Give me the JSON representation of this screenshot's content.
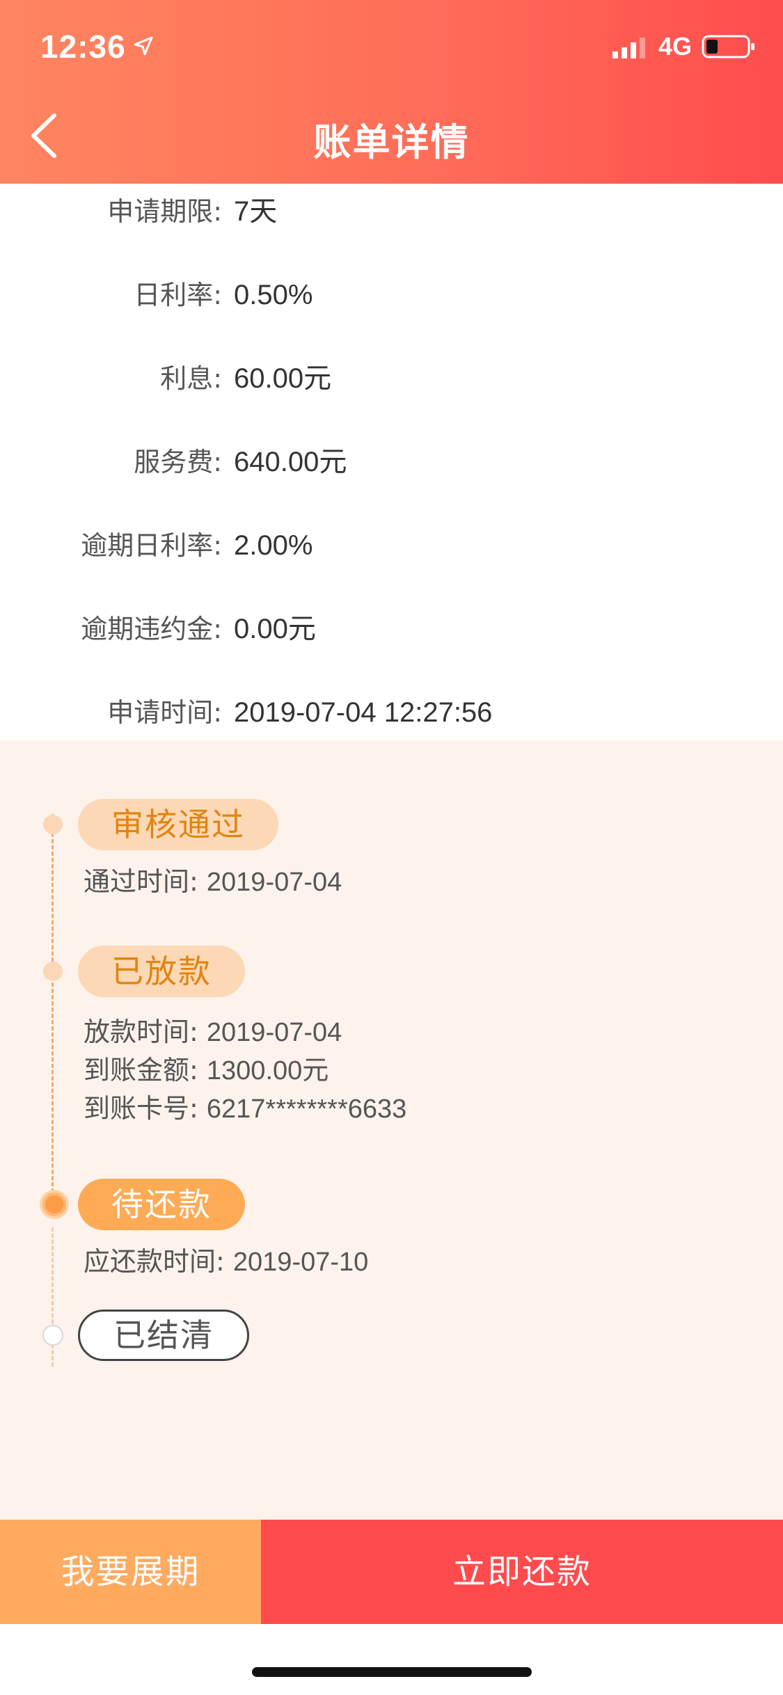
{
  "status_bar": {
    "time": "12:36",
    "network": "4G"
  },
  "nav": {
    "title": "账单详情"
  },
  "details": [
    {
      "label": "申请期限:",
      "value": "7天"
    },
    {
      "label": "日利率:",
      "value": "0.50%"
    },
    {
      "label": "利息:",
      "value": "60.00元"
    },
    {
      "label": "服务费:",
      "value": "640.00元"
    },
    {
      "label": "逾期日利率:",
      "value": "2.00%"
    },
    {
      "label": "逾期违约金:",
      "value": "0.00元"
    },
    {
      "label": "申请时间:",
      "value": "2019-07-04 12:27:56"
    }
  ],
  "timeline": {
    "steps": [
      {
        "status": "审核通过",
        "lines": [
          {
            "key": "通过时间:",
            "value": "2019-07-04"
          }
        ]
      },
      {
        "status": "已放款",
        "lines": [
          {
            "key": "放款时间:",
            "value": "2019-07-04"
          },
          {
            "key": "到账金额:",
            "value": "1300.00元"
          },
          {
            "key": "到账卡号:",
            "value": "6217********6633"
          }
        ]
      },
      {
        "status": "待还款",
        "lines": [
          {
            "key": "应还款时间:",
            "value": "2019-07-10"
          }
        ]
      },
      {
        "status": "已结清",
        "lines": []
      }
    ]
  },
  "actions": {
    "extend_label": "我要展期",
    "repay_label": "立即还款"
  },
  "colors": {
    "header_start": "#ff8560",
    "header_end": "#ff4c4d",
    "extend": "#ffaa5f",
    "repay": "#ff4b4e",
    "accent": "#e08511"
  }
}
